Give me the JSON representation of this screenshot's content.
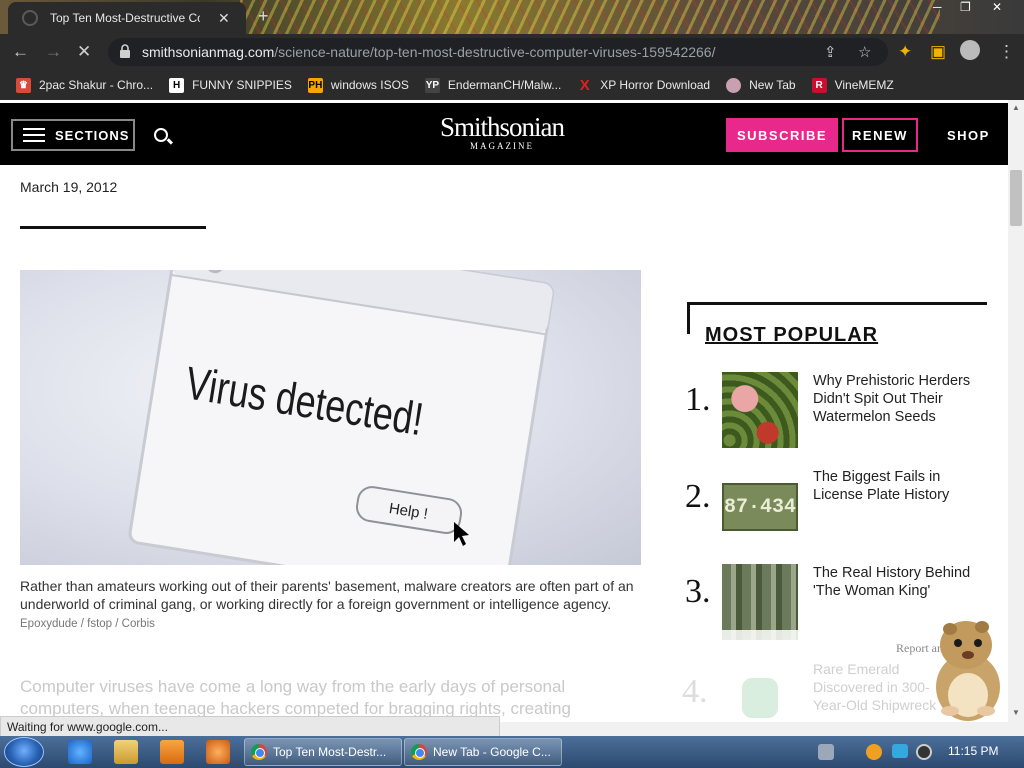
{
  "browser": {
    "tab_title": "Top Ten Most-Destructive Comp",
    "new_tab_symbol": "+",
    "url_host": "smithsonianmag.com",
    "url_path": "/science-nature/top-ten-most-destructive-computer-viruses-159542266/",
    "status_text": "Waiting for www.google.com...",
    "bookmarks": [
      {
        "label": "2pac Shakur - Chro...",
        "icon": "tupac-icon",
        "color": "#d94a3a"
      },
      {
        "label": "FUNNY SNIPPIES",
        "icon": "H",
        "color": "#ffffff"
      },
      {
        "label": "windows ISOS",
        "icon": "PH",
        "color": "#f7a600"
      },
      {
        "label": "EndermanCH/Malw...",
        "icon": "YP",
        "color": "#222222"
      },
      {
        "label": "XP Horror Download",
        "icon": "X",
        "color": "#e02020"
      },
      {
        "label": "New Tab",
        "icon": "globe",
        "color": "#cc4466"
      },
      {
        "label": "VineMEMZ",
        "icon": "R",
        "color": "#c8102e"
      }
    ]
  },
  "site": {
    "sections_label": "SECTIONS",
    "logo_main": "Smithsonian",
    "logo_sub": "MAGAZINE",
    "subscribe_label": "SUBSCRIBE",
    "renew_label": "RENEW",
    "shop_label": "SHOP",
    "accent_color": "#e8288a"
  },
  "article": {
    "date": "March 19, 2012",
    "hero_text": "Virus detected!",
    "hero_button": "Help !",
    "caption": "Rather than amateurs working out of their parents' basement, malware creators are often part of an underworld of criminal gang, or working directly for a foreign government or intelligence agency.",
    "caption_credit": "Epoxydude / fstop / Corbis",
    "body_faded": "Computer viruses have come a long way from the early days of personal computers, when teenage hackers competed for bragging rights, creating"
  },
  "most_popular": {
    "heading": "MOST POPULAR",
    "items": [
      {
        "num": "1.",
        "title": "Why Prehistoric Herders Didn't Spit Out Their Watermelon Seeds"
      },
      {
        "num": "2.",
        "title": "The Biggest Fails in License Plate History"
      },
      {
        "num": "3.",
        "title": "The Real History Behind 'The Woman King'"
      },
      {
        "num": "4.",
        "title": "Rare Emerald Discovered in 300-Year-Old Shipwreck"
      }
    ],
    "report_ad": "Report an ad"
  },
  "taskbar": {
    "tasks": [
      {
        "label": "Top Ten Most-Destr..."
      },
      {
        "label": "New Tab - Google C..."
      }
    ],
    "clock": "11:15 PM"
  }
}
